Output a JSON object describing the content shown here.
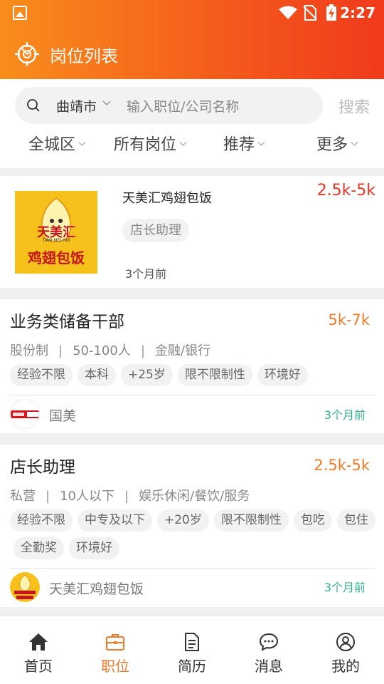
{
  "status_bar": {
    "time": "2:27"
  },
  "header": {
    "title": "岗位列表"
  },
  "search": {
    "city": "曲靖市",
    "placeholder": "输入职位/公司名称",
    "button_label": "搜索"
  },
  "filters": [
    {
      "label": "全城区"
    },
    {
      "label": "所有岗位"
    },
    {
      "label": "推荐"
    },
    {
      "label": "更多"
    }
  ],
  "featured": {
    "company": "天美汇鸡翅包饭",
    "salary": "2.5k-5k",
    "tag": "店长助理",
    "posted": "3个月前",
    "logo_text_top": "天美汇",
    "logo_text_small": "TIAN MEI HUI",
    "logo_text_bottom": "鸡翅包饭"
  },
  "jobs": [
    {
      "title": "业务类储备干部",
      "salary": "5k-7k",
      "meta": [
        "股份制",
        "50-100人",
        "金融/银行"
      ],
      "tags": [
        "经验不限",
        "本科",
        "+25岁",
        "限不限制性",
        "环境好"
      ],
      "company": "国美",
      "posted": "3个月前"
    },
    {
      "title": "店长助理",
      "salary": "2.5k-5k",
      "meta": [
        "私营",
        "10人以下",
        "娱乐休闲/餐饮/服务"
      ],
      "tags": [
        "经验不限",
        "中专及以下",
        "+20岁",
        "限不限制性",
        "包吃",
        "包住",
        "全勤奖",
        "环境好"
      ],
      "company": "天美汇鸡翅包饭",
      "posted": "3个月前"
    }
  ],
  "bottom_nav": [
    {
      "label": "首页",
      "icon": "home-icon"
    },
    {
      "label": "职位",
      "icon": "briefcase-icon"
    },
    {
      "label": "简历",
      "icon": "document-icon"
    },
    {
      "label": "消息",
      "icon": "chat-icon"
    },
    {
      "label": "我的",
      "icon": "profile-icon"
    }
  ],
  "colors": {
    "header_start": "#f98d1c",
    "header_end": "#f03a1c",
    "accent": "#f07a28",
    "salary_red": "#e73526",
    "time_green": "#2fb58b"
  }
}
